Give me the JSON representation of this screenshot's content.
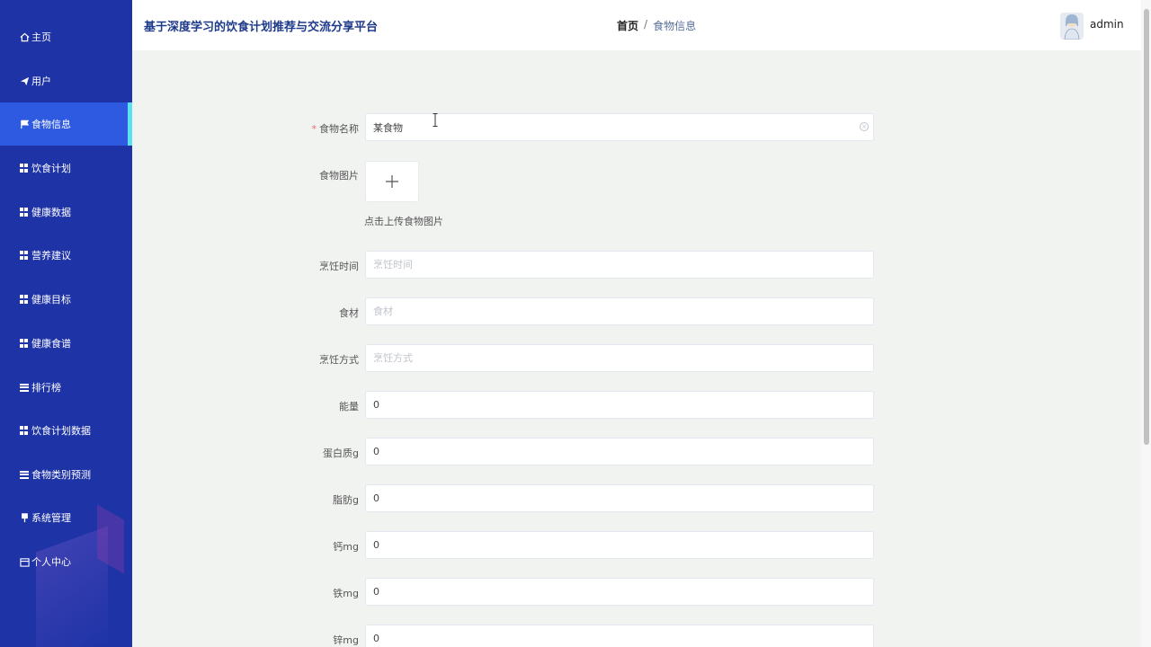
{
  "sidebar": {
    "items": [
      {
        "label": "主页",
        "icon": "home-icon"
      },
      {
        "label": "用户",
        "icon": "send-icon"
      },
      {
        "label": "食物信息",
        "icon": "flag-icon"
      },
      {
        "label": "饮食计划",
        "icon": "grid-icon"
      },
      {
        "label": "健康数据",
        "icon": "grid-icon"
      },
      {
        "label": "营养建议",
        "icon": "grid-icon"
      },
      {
        "label": "健康目标",
        "icon": "grid-icon"
      },
      {
        "label": "健康食谱",
        "icon": "grid-icon"
      },
      {
        "label": "排行榜",
        "icon": "list-icon"
      },
      {
        "label": "饮食计划数据",
        "icon": "grid-icon"
      },
      {
        "label": "食物类别预测",
        "icon": "list-icon"
      },
      {
        "label": "系统管理",
        "icon": "pin-icon"
      },
      {
        "label": "个人中心",
        "icon": "calendar-icon"
      }
    ],
    "active_index": 2,
    "colors": {
      "background": "#1e33a6",
      "active": "#2d5ae0",
      "accent": "#5ce1f0"
    }
  },
  "header": {
    "title": "基于深度学习的饮食计划推荐与交流分享平台",
    "breadcrumb": {
      "home": "首页",
      "separator": "/",
      "current": "食物信息"
    },
    "username": "admin"
  },
  "form": {
    "food_name": {
      "label": "食物名称",
      "required_mark": "*",
      "value": "某食物"
    },
    "food_image": {
      "label": "食物图片",
      "upload_tip": "点击上传食物图片"
    },
    "cook_time": {
      "label": "烹饪时间",
      "placeholder": "烹饪时间",
      "value": ""
    },
    "ingredients": {
      "label": "食材",
      "placeholder": "食材",
      "value": ""
    },
    "cook_method": {
      "label": "烹饪方式",
      "placeholder": "烹饪方式",
      "value": ""
    },
    "energy": {
      "label": "能量",
      "value": "0"
    },
    "protein": {
      "label": "蛋白质g",
      "value": "0"
    },
    "fat": {
      "label": "脂肪g",
      "value": "0"
    },
    "calcium": {
      "label": "钙mg",
      "value": "0"
    },
    "iron": {
      "label": "铁mg",
      "value": "0"
    },
    "zinc": {
      "label": "锌mg",
      "value": "0"
    }
  }
}
